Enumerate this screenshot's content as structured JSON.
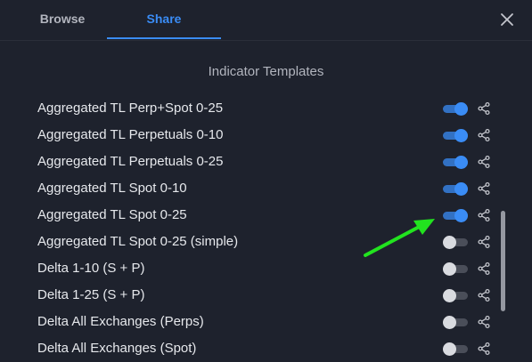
{
  "tabs": [
    {
      "label": "Browse",
      "active": false
    },
    {
      "label": "Share",
      "active": true
    }
  ],
  "section_title": "Indicator Templates",
  "accent_color": "#3a8cf5",
  "annotation_color": "#22e31f",
  "items": [
    {
      "label": "Aggregated TL Perp+Spot 0-25",
      "enabled": true
    },
    {
      "label": "Aggregated TL Perpetuals 0-10",
      "enabled": true
    },
    {
      "label": "Aggregated TL Perpetuals 0-25",
      "enabled": true
    },
    {
      "label": "Aggregated TL Spot 0-10",
      "enabled": true
    },
    {
      "label": "Aggregated TL Spot 0-25",
      "enabled": true
    },
    {
      "label": "Aggregated TL Spot 0-25 (simple)",
      "enabled": false
    },
    {
      "label": "Delta 1-10 (S + P)",
      "enabled": false
    },
    {
      "label": "Delta 1-25 (S + P)",
      "enabled": false
    },
    {
      "label": "Delta All Exchanges (Perps)",
      "enabled": false
    },
    {
      "label": "Delta All Exchanges (Spot)",
      "enabled": false
    }
  ],
  "icons": {
    "close": "close-icon",
    "share": "share-icon"
  }
}
